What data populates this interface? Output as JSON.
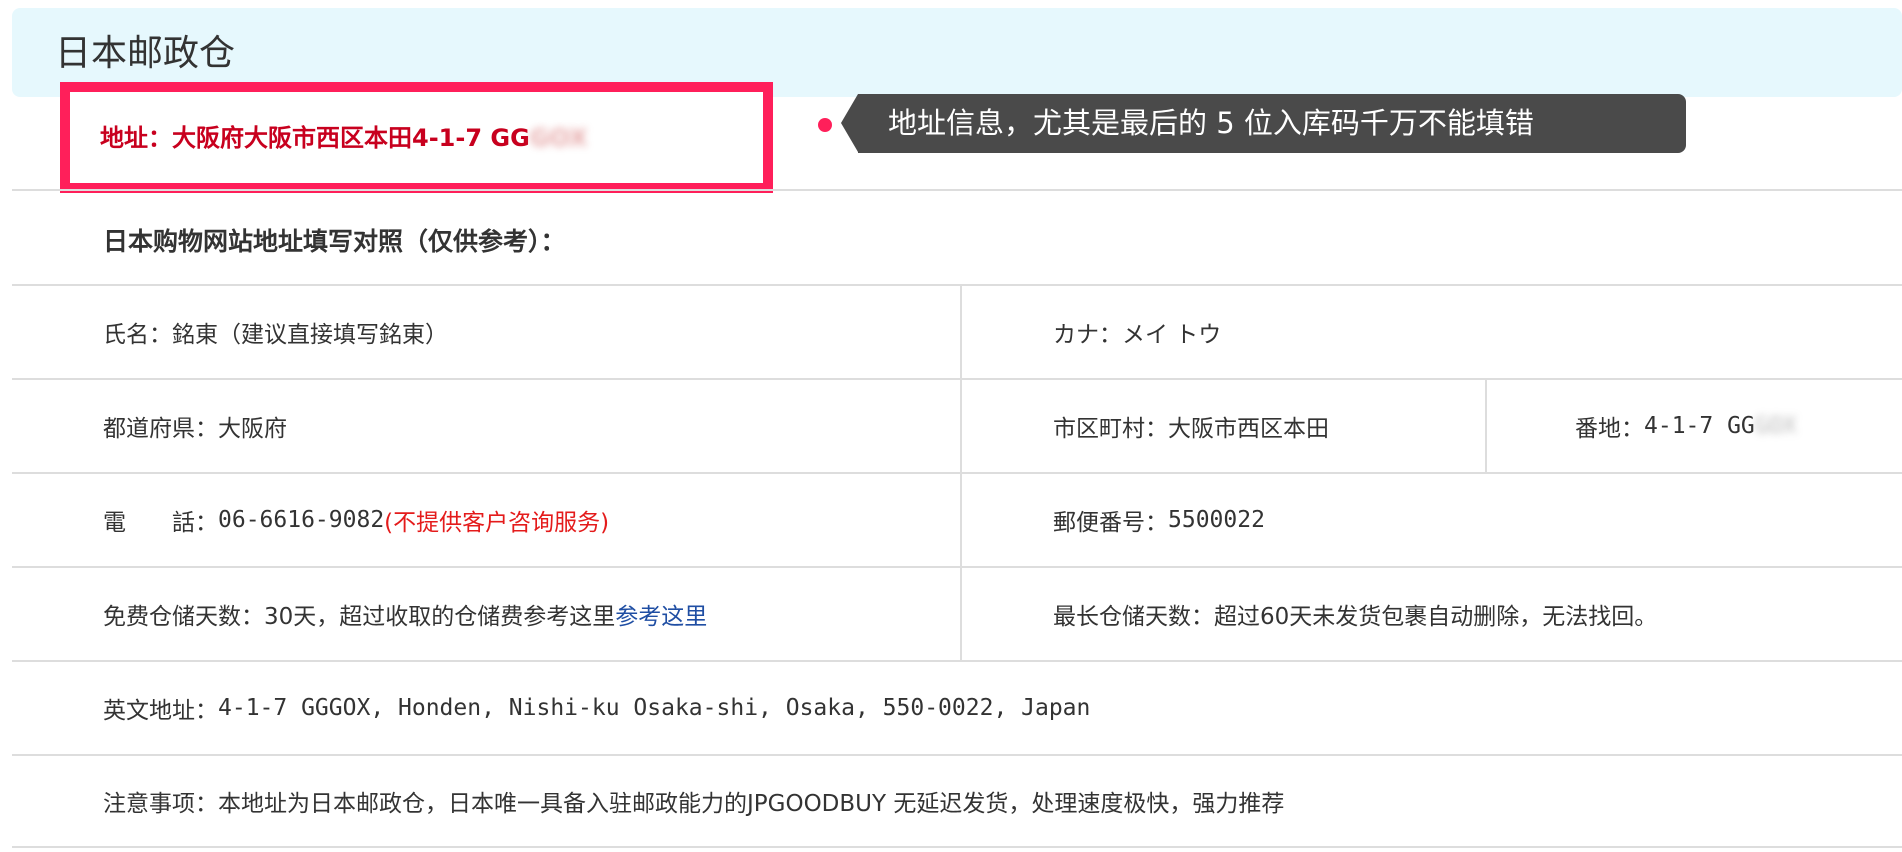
{
  "header": {
    "title": "日本邮政仓"
  },
  "highlight": {
    "label": "地址：",
    "address": "大阪府大阪市西区本田4-1-7 GG",
    "blurred": "GOX"
  },
  "tooltip": {
    "text": "地址信息，尤其是最后的 5 位入库码千万不能填错"
  },
  "subheading": "日本购物网站地址填写对照（仅供参考）：",
  "rows": {
    "name": {
      "label": "氏名：",
      "value": "銘東（建议直接填写銘東）"
    },
    "kana": {
      "label": "カナ：",
      "value": "メイ トウ"
    },
    "prefecture": {
      "label": "都道府県：",
      "value": "大阪府"
    },
    "city": {
      "label": "市区町村：",
      "value": "大阪市西区本田"
    },
    "banchi": {
      "label": "番地：",
      "value": "4-1-7 GG",
      "blurred": "GOX"
    },
    "phone": {
      "label": "電　　話：",
      "value": "06-6616-9082",
      "note": "(不提供客户咨询服务)"
    },
    "postal": {
      "label": "郵便番号：",
      "value": "5500022"
    },
    "storage_free": {
      "label": "免费仓储天数：",
      "value": "30天，超过收取的仓储费参考这里",
      "link": "参考这里"
    },
    "storage_max": {
      "label": "最长仓储天数：",
      "value": "超过60天未发货包裹自动删除，无法找回。"
    },
    "english": {
      "label": "英文地址：",
      "value": "4-1-7 GGGOX, Honden, Nishi-ku Osaka-shi, Osaka, 550-0022, Japan"
    },
    "notes": {
      "label": "注意事项：",
      "value": "本地址为日本邮政仓，日本唯一具备入驻邮政能力的JPGOODBUY 无延迟发货，处理速度极快，强力推荐"
    }
  },
  "colors": {
    "accent": "#ff1f5a",
    "address_red": "#c8001e",
    "link": "#1f4ea3",
    "header_bg": "#e6f8fd",
    "tooltip_bg": "#4a4a4a"
  }
}
